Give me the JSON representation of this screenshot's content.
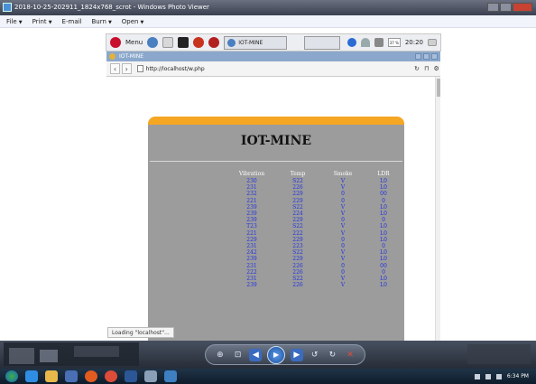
{
  "photo_viewer": {
    "title": "2018-10-25-202911_1824x768_scrot - Windows Photo Viewer",
    "menu": [
      {
        "label": "File"
      },
      {
        "label": "Print"
      },
      {
        "label": "E-mail"
      },
      {
        "label": "Burn"
      },
      {
        "label": "Open"
      }
    ],
    "colors": {
      "title_bar": "#3a4050",
      "control_bar": "#262d38"
    }
  },
  "rpi_taskbar": {
    "menu_label": "Menu",
    "task_label": "IOT-MINE",
    "cpu_label": "37 %",
    "clock": "20:20"
  },
  "browser": {
    "tab_title": "IOT-MINE",
    "url": "http://localhost/w.php",
    "status": "Loading \"localhost\"..."
  },
  "page": {
    "heading": "IOT-MINE",
    "accent_color": "#f5a623",
    "panel_color": "#9c9c9c",
    "value_color": "#2233dd",
    "columns": [
      "Vibration",
      "Temp",
      "Smoke",
      "LDR"
    ],
    "rows": [
      [
        "230",
        "S22",
        "V",
        "L0"
      ],
      [
        "231",
        "226",
        "V",
        "L0"
      ],
      [
        "232",
        "229",
        "0",
        "00"
      ],
      [
        "221",
        "229",
        "0",
        "0"
      ],
      [
        "239",
        "S22",
        "V",
        "L0"
      ],
      [
        "239",
        "224",
        "V",
        "L0"
      ],
      [
        "239",
        "229",
        "0",
        "0"
      ],
      [
        "T23",
        "S22",
        "V",
        "L0"
      ],
      [
        "221",
        "222",
        "V",
        "L0"
      ],
      [
        "229",
        "229",
        "0",
        "L0"
      ],
      [
        "231",
        "223",
        "0",
        "0"
      ],
      [
        "242",
        "S22",
        "V",
        "L0"
      ],
      [
        "239",
        "229",
        "V",
        "L0"
      ],
      [
        "231",
        "226",
        "0",
        "00"
      ],
      [
        "222",
        "226",
        "0",
        "0"
      ],
      [
        "231",
        "S22",
        "V",
        "L0"
      ],
      [
        "239",
        "226",
        "V",
        "L0"
      ]
    ]
  },
  "taskbar": {
    "clock": "6:34 PM"
  }
}
